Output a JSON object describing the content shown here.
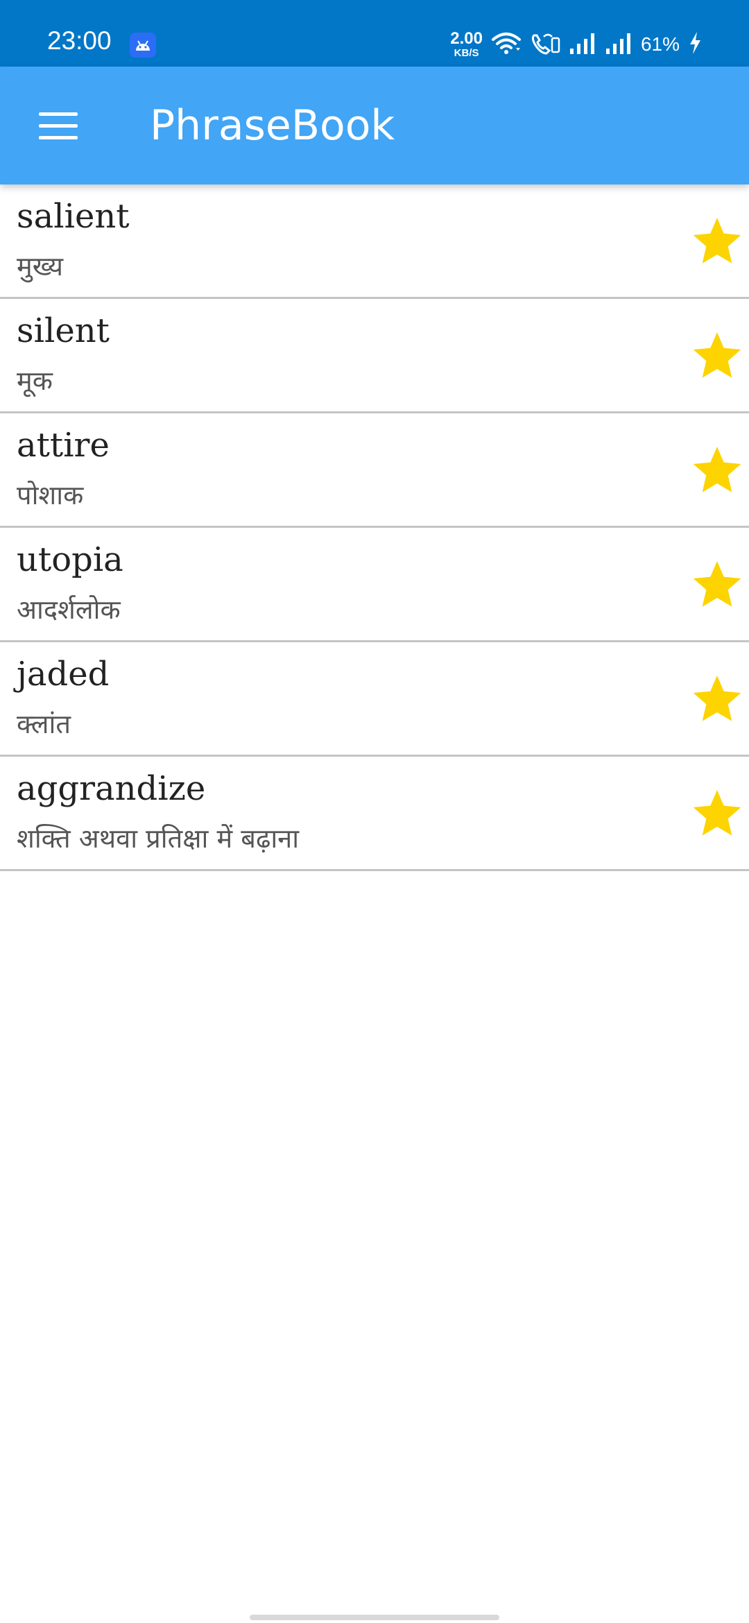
{
  "status_bar": {
    "time": "23:00",
    "net_speed_value": "2.00",
    "net_speed_unit": "KB/S",
    "battery_percent": "61%",
    "icons": [
      "android-notification-icon",
      "wifi-icon",
      "vowifi-call-icon",
      "signal-icon",
      "signal-icon",
      "charging-icon"
    ]
  },
  "app_bar": {
    "title": "PhraseBook",
    "menu_icon": "hamburger-menu-icon"
  },
  "colors": {
    "status_bar": "#0277c8",
    "app_bar": "#42a5f5",
    "star": "#fdd300"
  },
  "words": [
    {
      "english": "salient",
      "hindi": "मुख्य",
      "starred": true
    },
    {
      "english": "silent",
      "hindi": "मूक",
      "starred": true
    },
    {
      "english": "attire",
      "hindi": "पोशाक",
      "starred": true
    },
    {
      "english": "utopia",
      "hindi": "आदर्शलोक",
      "starred": true
    },
    {
      "english": "jaded",
      "hindi": "क्लांत",
      "starred": true
    },
    {
      "english": "aggrandize",
      "hindi": "शक्ति अथवा प्रतिक्षा में बढ़ाना",
      "starred": true
    }
  ]
}
